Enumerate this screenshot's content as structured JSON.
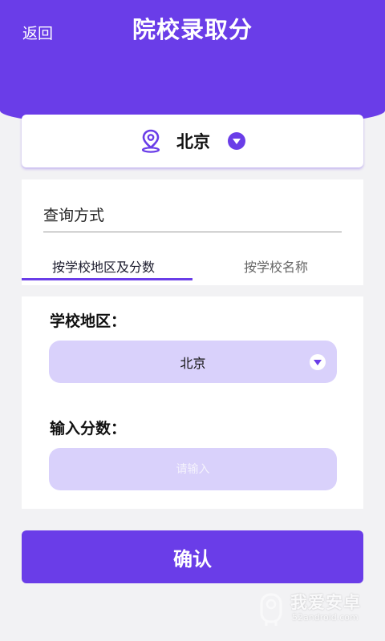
{
  "header": {
    "back_label": "返回",
    "title": "院校录取分"
  },
  "location": {
    "city": "北京",
    "icons": [
      "location-pin-icon",
      "dropdown-icon"
    ]
  },
  "query": {
    "label": "查询方式",
    "tabs": [
      {
        "label": "按学校地区及分数",
        "active": true
      },
      {
        "label": "按学校名称",
        "active": false
      }
    ]
  },
  "form": {
    "region_label": "学校地区：",
    "region_value": "北京",
    "score_label": "输入分数：",
    "score_placeholder": "请输入",
    "score_value": ""
  },
  "confirm_label": "确认",
  "watermark": {
    "name": "我爱安卓",
    "url": "52android.com"
  },
  "colors": {
    "accent": "#6a3de8",
    "field_bg": "#d9d1fb",
    "page_bg": "#f2f2f4"
  }
}
